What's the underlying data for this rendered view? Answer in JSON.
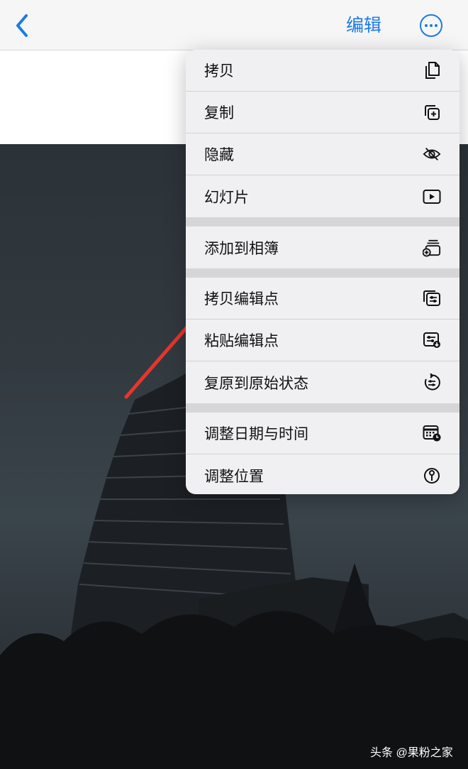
{
  "navbar": {
    "back_icon": "chevron-left-icon",
    "edit_label": "编辑",
    "more_icon": "ellipsis-circle-icon",
    "accent_color": "#1a7be5"
  },
  "menu": {
    "groups": [
      {
        "items": [
          {
            "label": "拷贝",
            "icon": "copy-icon"
          },
          {
            "label": "复制",
            "icon": "duplicate-icon"
          },
          {
            "label": "隐藏",
            "icon": "eye-slash-icon"
          },
          {
            "label": "幻灯片",
            "icon": "play-rectangle-icon"
          }
        ]
      },
      {
        "items": [
          {
            "label": "添加到相簿",
            "icon": "add-to-album-icon"
          }
        ]
      },
      {
        "items": [
          {
            "label": "拷贝编辑点",
            "icon": "copy-edits-icon"
          },
          {
            "label": "粘贴编辑点",
            "icon": "paste-edits-icon"
          },
          {
            "label": "复原到原始状态",
            "icon": "revert-icon"
          }
        ]
      },
      {
        "items": [
          {
            "label": "调整日期与时间",
            "icon": "calendar-clock-icon"
          },
          {
            "label": "调整位置",
            "icon": "location-pin-icon"
          }
        ]
      }
    ]
  },
  "annotation": {
    "arrow_color": "#e8352b"
  },
  "watermark": "头条 @果粉之家"
}
